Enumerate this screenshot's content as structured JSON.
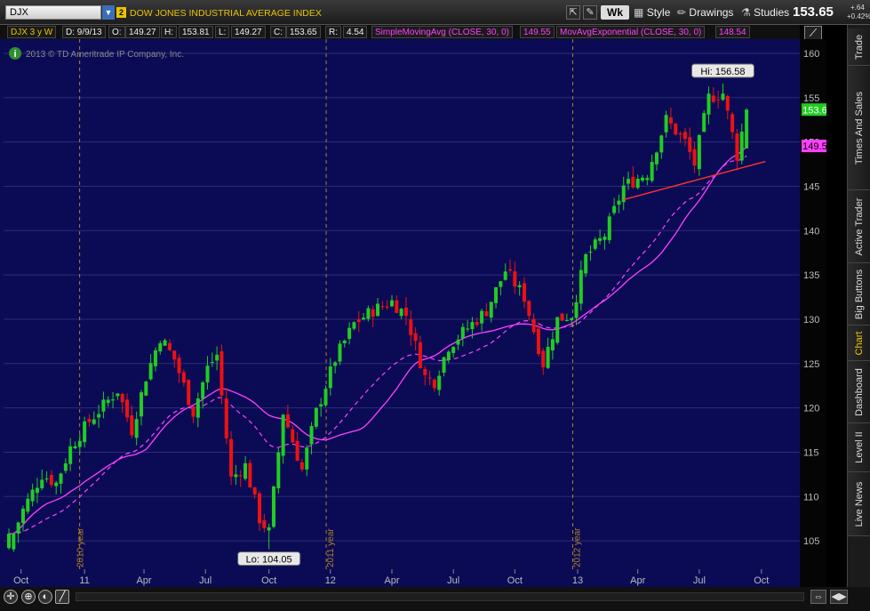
{
  "topbar": {
    "symbol": "DJX",
    "link_number": "2",
    "description": "DOW JONES INDUSTRIAL AVERAGE INDEX",
    "period_button": "Wk",
    "style_label": "Style",
    "drawings_label": "Drawings",
    "studies_label": "Studies",
    "last_price": "153.65",
    "change": "+.64",
    "change_pct": "+0.42%"
  },
  "infobar": {
    "symbol_period": "DJX 3 y W",
    "date": "D: 9/9/13",
    "open_label": "O:",
    "open": "149.27",
    "high_label": "H:",
    "high": "153.81",
    "low_label": "L:",
    "low": "149.27",
    "close_label": "C:",
    "close": "153.65",
    "range_label": "R:",
    "range": "4.54",
    "sma_label": "SimpleMovingAvg (CLOSE, 30, 0)",
    "sma_value": "149.55",
    "ema_label": "MovAvgExponential (CLOSE, 30, 0)",
    "ema_value": "148.54"
  },
  "copyright": "2013 © TD Ameritrade IP Company, Inc.",
  "side_tabs": [
    "Trade",
    "Times And Sales",
    "Active Trader",
    "Big Buttons",
    "Chart",
    "Dashboard",
    "Level II",
    "Live News"
  ],
  "active_tab": "Chart",
  "colors": {
    "background": "#0b0b55",
    "up": "#22cc22",
    "down": "#ee1111",
    "sma": "#ff40ff",
    "ema": "#ff40ff",
    "trendline": "#ff3030",
    "year_divider": "#b08020",
    "label_yellow": "#e9c400"
  },
  "chart_data": {
    "type": "candlestick",
    "x_tick_labels": [
      "Oct",
      "11",
      "Apr",
      "Jul",
      "Oct",
      "12",
      "Apr",
      "Jul",
      "Oct",
      "13",
      "Apr",
      "Jul",
      "Oct"
    ],
    "year_markers": [
      "2010 year",
      "2011 year",
      "2012 year"
    ],
    "ylim": [
      101,
      161
    ],
    "y_ticks": [
      105,
      110,
      115,
      120,
      125,
      130,
      135,
      140,
      145,
      150,
      155,
      160
    ],
    "high_label": "Hi: 156.58",
    "low_label": "Lo: 104.05",
    "price_tags": [
      {
        "value": 153.65,
        "color": "#22cc22",
        "text": "153.65"
      },
      {
        "value": 149.55,
        "color": "#ff40ff",
        "text": "149.55"
      }
    ],
    "anchors": [
      [
        "2010-09-13",
        104.5
      ],
      [
        "2010-10-04",
        108.5
      ],
      [
        "2010-11-01",
        112.5
      ],
      [
        "2010-11-22",
        111.5
      ],
      [
        "2010-12-13",
        115.5
      ],
      [
        "2011-01-10",
        118.5
      ],
      [
        "2011-02-21",
        122.0
      ],
      [
        "2011-03-14",
        117.5
      ],
      [
        "2011-04-04",
        123.5
      ],
      [
        "2011-04-25",
        128.0
      ],
      [
        "2011-05-16",
        125.5
      ],
      [
        "2011-06-13",
        119.5
      ],
      [
        "2011-07-04",
        124.5
      ],
      [
        "2011-07-18",
        126.0
      ],
      [
        "2011-08-08",
        112.0
      ],
      [
        "2011-08-29",
        113.5
      ],
      [
        "2011-09-19",
        107.5
      ],
      [
        "2011-10-03",
        106.0
      ],
      [
        "2011-10-24",
        119.5
      ],
      [
        "2011-11-21",
        113.0
      ],
      [
        "2011-12-12",
        119.5
      ],
      [
        "2012-01-09",
        125.5
      ],
      [
        "2012-02-06",
        129.5
      ],
      [
        "2012-03-05",
        131.0
      ],
      [
        "2012-04-02",
        132.0
      ],
      [
        "2012-04-23",
        130.5
      ],
      [
        "2012-05-21",
        123.5
      ],
      [
        "2012-06-04",
        123.0
      ],
      [
        "2012-06-25",
        127.0
      ],
      [
        "2012-07-23",
        129.0
      ],
      [
        "2012-08-20",
        131.0
      ],
      [
        "2012-09-17",
        135.5
      ],
      [
        "2012-10-15",
        132.5
      ],
      [
        "2012-11-12",
        125.0
      ],
      [
        "2012-12-03",
        130.0
      ],
      [
        "2012-12-24",
        130.5
      ],
      [
        "2013-01-14",
        137.0
      ],
      [
        "2013-02-11",
        139.5
      ],
      [
        "2013-03-11",
        145.0
      ],
      [
        "2013-04-15",
        146.5
      ],
      [
        "2013-05-13",
        152.5
      ],
      [
        "2013-06-10",
        150.0
      ],
      [
        "2013-06-24",
        147.5
      ],
      [
        "2013-07-15",
        155.0
      ],
      [
        "2013-08-05",
        155.5
      ],
      [
        "2013-08-26",
        148.5
      ],
      [
        "2013-09-09",
        153.65
      ]
    ],
    "extremes": {
      "high": [
        156.58,
        "2013-08-05"
      ],
      "low": [
        104.05,
        "2011-10-03"
      ]
    },
    "last_bar": {
      "date": "2013-09-09",
      "open": 149.27,
      "high": 153.81,
      "low": 149.27,
      "close": 153.65
    },
    "trendline": {
      "from": [
        "2013-03-11",
        143.5
      ],
      "to": [
        "2013-10-07",
        147.8
      ]
    },
    "sma_period": 30,
    "ema_period": 30
  }
}
